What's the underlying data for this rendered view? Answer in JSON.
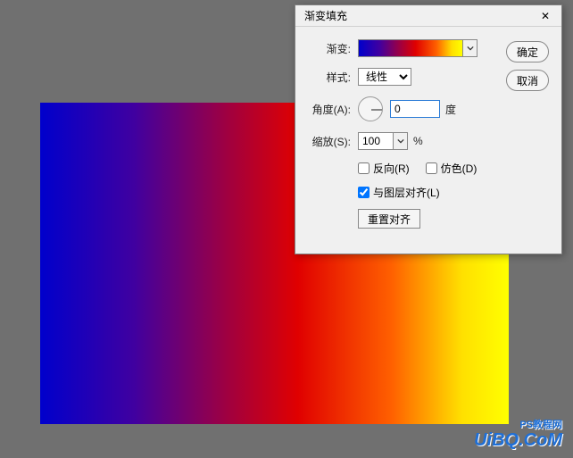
{
  "dialog": {
    "title": "渐变填充",
    "ok": "确定",
    "cancel": "取消",
    "gradient_label": "渐变:",
    "style_label": "样式:",
    "style_value": "线性",
    "angle_label": "角度(A):",
    "angle_value": "0",
    "angle_unit": "度",
    "scale_label": "缩放(S):",
    "scale_value": "100",
    "scale_unit": "%",
    "reverse_label": "反向(R)",
    "dither_label": "仿色(D)",
    "align_label": "与图层对齐(L)",
    "reset_label": "重置对齐",
    "reverse_checked": false,
    "dither_checked": false,
    "align_checked": true
  },
  "gradient_stops": [
    "#0000cc",
    "#e00000",
    "#ffff00"
  ],
  "watermark": {
    "logo": "UiBQ.CoM",
    "tag": "PS教程网"
  }
}
